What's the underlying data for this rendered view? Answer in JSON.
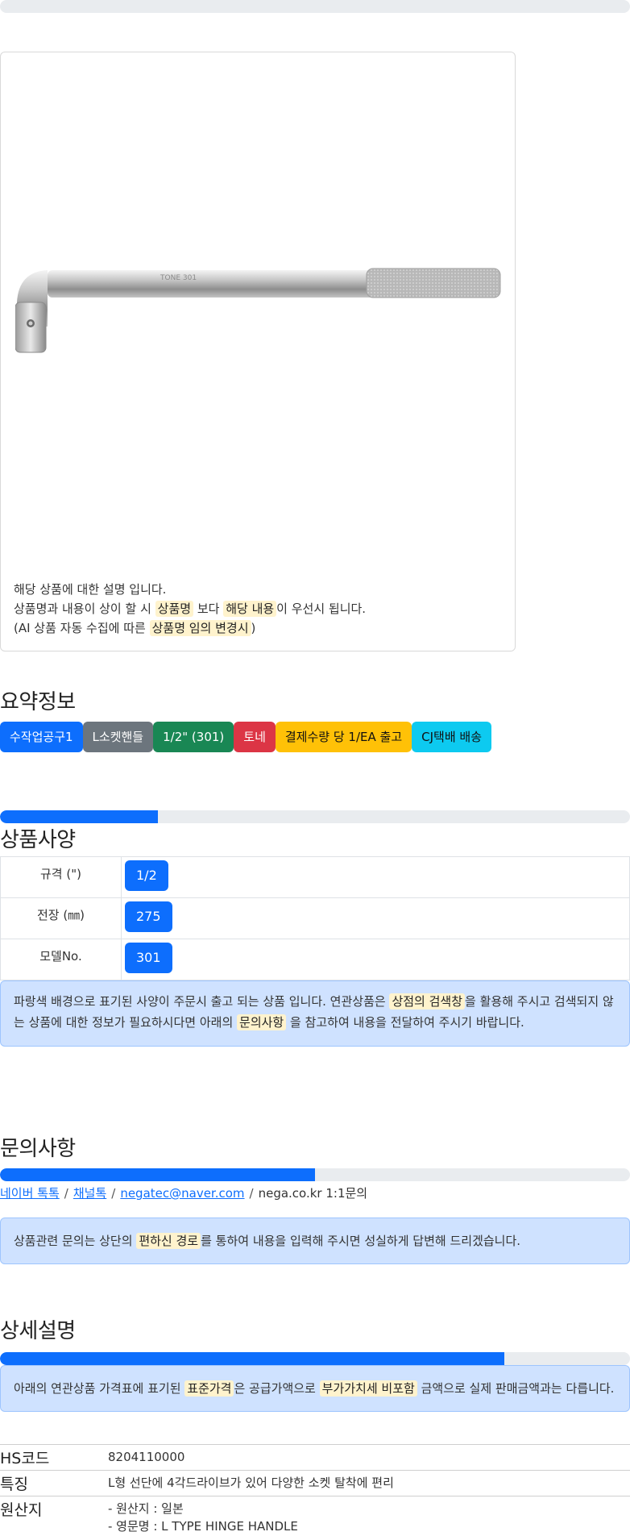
{
  "progress": {
    "top": 0,
    "spec": 25,
    "inquiry": 50,
    "detail": 80
  },
  "product_card": {
    "line1": "해당 상품에 대한 설명 입니다.",
    "line2_a": "상품명과 내용이 상이 할 시 ",
    "line2_hl1": "상품명",
    "line2_b": " 보다 ",
    "line2_hl2": "해당 내용",
    "line2_c": "이 우선시 됩니다.",
    "line3_a": "(AI 상품 자동 수집에 따른 ",
    "line3_hl": "상품명 임의 변경시",
    "line3_b": ")"
  },
  "summary": {
    "title": "요약정보",
    "badges": [
      "수작업공구1",
      "L소켓핸들",
      "1/2\" (301)",
      "토네",
      "결제수량 당 1/EA 출고",
      "CJ택배 배송"
    ]
  },
  "spec": {
    "title": "상품사양",
    "rows": [
      {
        "key": "규격 (\")",
        "value": "1/2"
      },
      {
        "key": "전장 (㎜)",
        "value": "275"
      },
      {
        "key": "모델No.",
        "value": "301"
      }
    ],
    "notice_a": "파랑색 배경으로 표기된 사양이 주문시 출고 되는 상품 입니다. 연관상품은 ",
    "notice_hl1": "상점의 검색창",
    "notice_b": "을 활용해 주시고 검색되지 않는 상품에 대한 정보가 필요하시다면 아래의 ",
    "notice_hl2": "문의사항",
    "notice_c": " 을 참고하여 내용을 전달하여 주시기 바랍니다."
  },
  "inquiry": {
    "title": "문의사항",
    "link1": "네이버 톡톡",
    "link2": "채널톡",
    "link3": "negatec@naver.com",
    "plain": "nega.co.kr 1:1문의",
    "sep": "/",
    "notice_a": "상품관련 문의는 상단의 ",
    "notice_hl": "편하신 경로",
    "notice_b": "를 통하여 내용을 입력해 주시면 성실하게 답변해 드리겠습니다."
  },
  "detail": {
    "title": "상세설명",
    "notice_a": "아래의 연관상품 가격표에 표기된 ",
    "notice_hl1": "표준가격",
    "notice_b": "은 공급가액으로 ",
    "notice_hl2": "부가가치세 비포함",
    "notice_c": " 금액으로 실제 판매금액과는 다릅니다.",
    "rows": [
      {
        "key": "HS코드",
        "lines": [
          "8204110000"
        ]
      },
      {
        "key": "특징",
        "lines": [
          "L형 선단에 4각드라이브가 있어 다양한 소켓 탈착에 편리"
        ]
      },
      {
        "key": "원산지",
        "lines": [
          "- 원산지 : 일본",
          "- 영문명 : L TYPE HINGE HANDLE"
        ]
      }
    ]
  },
  "colors": {
    "primary": "#0d6efd",
    "highlight": "#fff3cd",
    "alert_bg": "#cfe2ff"
  }
}
